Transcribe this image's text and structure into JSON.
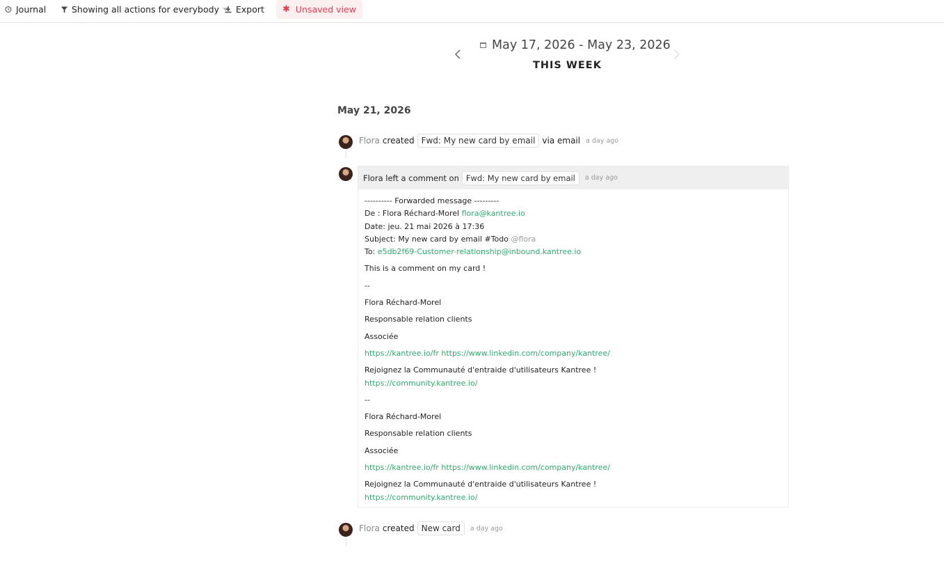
{
  "toolbar": {
    "journal": "Journal",
    "filter": "Showing all actions for everybody",
    "export": "Export",
    "unsaved": "Unsaved view"
  },
  "header": {
    "date_range": "May 17, 2026 - May 23, 2026",
    "week_label": "THIS WEEK"
  },
  "day": {
    "date": "May 21, 2026"
  },
  "activities": [
    {
      "user": "Flora",
      "verb": "created",
      "card": "Fwd: My new card by email",
      "suffix": "via email",
      "ago": "a day ago"
    },
    {
      "user": "Flora",
      "verb": "created",
      "card": "New card",
      "ago": "a day ago"
    }
  ],
  "comment": {
    "header_text": "Flora left a comment on",
    "card": "Fwd: My new card by email",
    "ago": "a day ago",
    "forwarded": "---------- Forwarded message ---------",
    "from_label": "De : Flora Réchard-Morel",
    "from_email": "flora@kantree.io",
    "date": "Date: jeu. 21 mai 2026 à 17:36",
    "subject": "Subject: My new card by email #Todo",
    "subject_mention": "@flora",
    "to_label": "To:",
    "to_email": "e5db2f69-Customer-relationship@inbound.kantree.io",
    "message": "This is a comment on my card !",
    "sig_sep": "--",
    "sig_name": "Flora Réchard-Morel",
    "sig_role": "Responsable relation clients",
    "sig_title": "Associée",
    "sig_link1": "https://kantree.io/fr",
    "sig_link2": "https://www.linkedin.com/company/kantree/",
    "community_text": "Rejoignez la Communauté d'entraide d'utilisateurs Kantree !",
    "community_link": "https://community.kantree.io/"
  },
  "colors": {
    "accent_green": "#2eaa6b",
    "unsaved_red": "#e53a4e"
  }
}
